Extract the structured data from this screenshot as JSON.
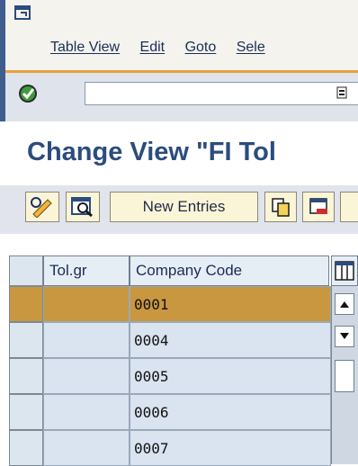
{
  "menu": {
    "items": [
      "Table View",
      "Edit",
      "Goto",
      "Sele"
    ]
  },
  "command_field": {
    "value": ""
  },
  "page": {
    "title": "Change View \"FI Tol"
  },
  "toolbar": {
    "new_entries_label": "New Entries"
  },
  "table": {
    "headers": [
      "Tol.gr",
      "Company Code"
    ],
    "rows": [
      {
        "tol_group": "",
        "company_code": "0001",
        "selected": true
      },
      {
        "tol_group": "",
        "company_code": "0004",
        "selected": false
      },
      {
        "tol_group": "",
        "company_code": "0005",
        "selected": false
      },
      {
        "tol_group": "",
        "company_code": "0006",
        "selected": false
      },
      {
        "tol_group": "",
        "company_code": "0007",
        "selected": false
      }
    ]
  },
  "colors": {
    "accent": "#e7a13b",
    "title": "#2b4c7e",
    "selected_row": "#c9973f"
  },
  "icons": [
    "system-menu-icon",
    "enter-check-icon",
    "command-dropdown-icon",
    "display-change-icon",
    "details-icon",
    "copy-icon",
    "delete-icon",
    "table-settings-icon",
    "scroll-up-icon",
    "scroll-down-icon"
  ]
}
